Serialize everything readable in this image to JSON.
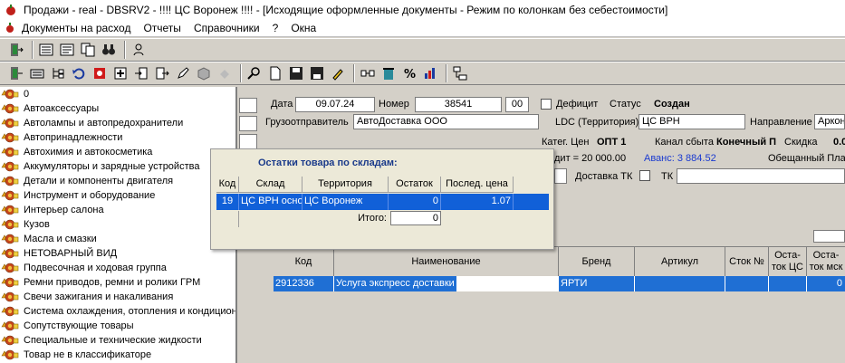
{
  "window": {
    "title": "Продажи - real - DBSRV2 -    !!!! ЦС Воронеж  !!!! - [Исходящие оформленные документы - Режим по колонкам без себестоимости]"
  },
  "menu": [
    "Документы на расход",
    "Отчеты",
    "Справочники",
    "?",
    "Окна"
  ],
  "tree": {
    "items": [
      "0",
      "Автоаксессуары",
      "Автолампы и автопредохранители",
      "Автопринадлежности",
      "Автохимия и автокосметика",
      "Аккумуляторы и зарядные устройства",
      "Детали и компоненты двигателя",
      "Инструмент и оборудование",
      "Интерьер салона",
      "Кузов",
      "Масла и смазки",
      "НЕТОВАРНЫЙ ВИД",
      "Подвесочная и ходовая группа",
      "Ремни приводов, ремни и ролики ГРМ",
      "Свечи зажигания и накаливания",
      "Система охлаждения, отопления и кондицион",
      "Сопутствующие товары",
      "Специальные и технические жидкости",
      "Товар не в классификаторе"
    ]
  },
  "header": {
    "date_label": "Дата",
    "date_value": "09.07.24",
    "number_label": "Номер",
    "number_value": "38541",
    "number_suffix": "00",
    "deficit_label": "Дефицит",
    "status_label": "Статус",
    "status_value": "Создан",
    "shipper_label": "Грузоотправитель",
    "shipper_value": "АвтоДоставка ООО",
    "ldc_label": "LDC (Территория)",
    "ldc_value": "ЦС ВРН",
    "direction_label": "Направление",
    "direction_value": "Аркон",
    "price_cat_label": "Катег. Цен",
    "price_cat_value": "ОПТ 1",
    "channel_label": "Канал сбыта",
    "channel_value": "Конечный П",
    "discount_label": "Скидка",
    "discount_value": "0.0",
    "credit_text": "дит = 20 000.00",
    "advance_text": "Аванс: 3 884.52",
    "obligatory_text": "Обещанный Плат",
    "delivery_tk_label": "Доставка ТК",
    "tk_label": "ТК",
    "advance_color": "#1a3ad0"
  },
  "popup": {
    "title": "Остатки товара по складам:",
    "columns": [
      "Код",
      "Склад",
      "Территория",
      "Остаток",
      "Послед. цена"
    ],
    "row": {
      "code": "19",
      "warehouse": "ЦС ВРН основ",
      "territory": "ЦС Воронеж",
      "rest": "0",
      "last_price": "1.07"
    },
    "total_label": "Итого:",
    "total_value": "0"
  },
  "grid": {
    "columns": [
      "Код",
      "Наименование",
      "Бренд",
      "Артикул",
      "Сток №",
      "Оста-\nток ЦС",
      "Оста-\nток мск"
    ],
    "row": {
      "code": "2912336",
      "name": "Услуга экспресс доставки",
      "brand": "ЯРТИ",
      "article": "",
      "stock_no": "",
      "rest_cs": "",
      "rest_msk": "0"
    }
  }
}
